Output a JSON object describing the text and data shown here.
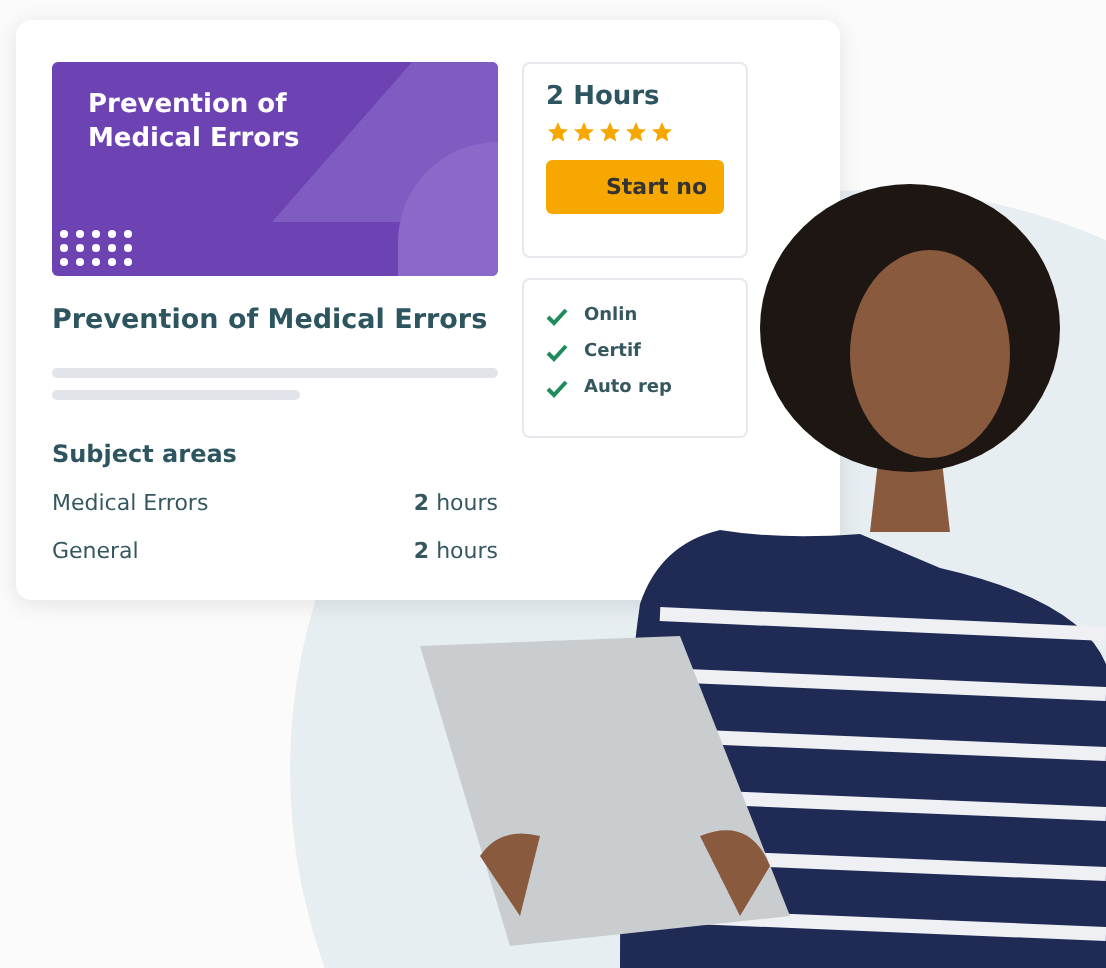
{
  "course_card": {
    "banner_title": "Prevention of Medical Errors",
    "title": "Prevention of Medical Errors",
    "subject_heading": "Subject areas",
    "subjects": [
      {
        "name": "Medical Errors",
        "hours_value": "2",
        "hours_unit": "hours"
      },
      {
        "name": "General",
        "hours_value": "2",
        "hours_unit": "hours"
      }
    ]
  },
  "purchase_box": {
    "duration": "2 Hours",
    "stars": 5,
    "button": "Start no"
  },
  "features": [
    {
      "label": "Onlin"
    },
    {
      "label": "Certif"
    },
    {
      "label": "Auto rep"
    }
  ]
}
